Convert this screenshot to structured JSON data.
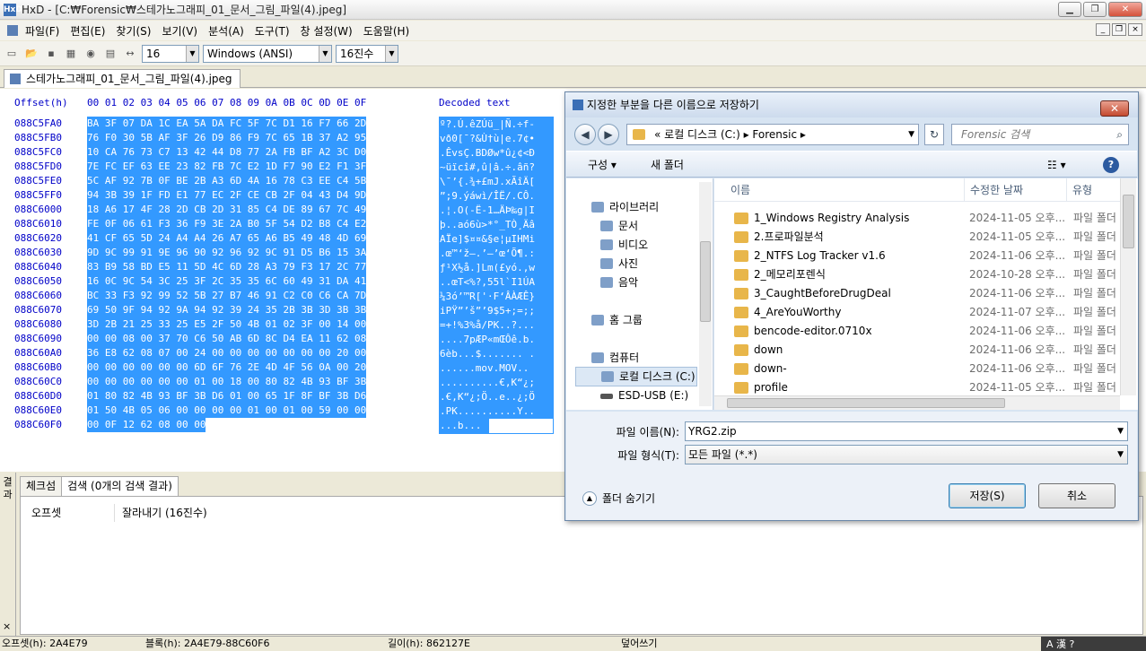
{
  "window": {
    "title": "HxD - [C:₩Forensic₩스테가노그래피_01_문서_그림_파일(4).jpeg]",
    "app_icon": "HxD",
    "minimize": "▁",
    "maximize": "❐",
    "close": "✕"
  },
  "menu": {
    "items": [
      "파일(F)",
      "편집(E)",
      "찾기(S)",
      "보기(V)",
      "분석(A)",
      "도구(T)",
      "창 설정(W)",
      "도움말(H)"
    ],
    "mdi": {
      "minimize": "_",
      "restore": "❐",
      "close": "×"
    }
  },
  "toolbar": {
    "bytes_per_row": "16",
    "charset": "Windows (ANSI)",
    "number_base": "16진수"
  },
  "document_tab": {
    "label": "스테가노그래피_01_문서_그림_파일(4).jpeg"
  },
  "hex_view": {
    "offset_header": "Offset(h)",
    "columns_header": "00 01 02 03 04 05 06 07 08 09 0A 0B 0C 0D 0E 0F",
    "decoded_header": "Decoded text",
    "rows": [
      {
        "offset": "088C5FA0",
        "hex": "BA 3F 07 DA 1C EA 5A DA FC 5F 7C D1 16 F7 66 2D",
        "text": "º?.Ú.êZÚü_|Ñ.÷f-"
      },
      {
        "offset": "088C5FB0",
        "hex": "76 F0 30 5B AF 3F 26 D9 86 F9 7C 65 1B 37 A2 95",
        "text": "vð0[¯?&Ù†ù|e.7¢•"
      },
      {
        "offset": "088C5FC0",
        "hex": "10 CA 76 73 C7 13 42 44 D8 77 2A FB BF A2 3C D0",
        "text": ".ÊvsÇ.BDØw*û¿¢<Ð"
      },
      {
        "offset": "088C5FD0",
        "hex": "7E FC EF 63 EE 23 82 FB 7C E2 1D F7 90 E2 F1 3F",
        "text": "~üïcî#‚û|â.÷.âñ?"
      },
      {
        "offset": "088C5FE0",
        "hex": "5C AF 92 7B 0F BE 2B A3 6D 4A 16 78 C3 EE C4 5B",
        "text": "\\¯’{.¾+£mJ.xÃîÄ["
      },
      {
        "offset": "088C5FF0",
        "hex": "94 3B 39 1F FD E1 77 EC 2F CE CB 2F 04 43 D4 9D",
        "text": "”;9.ýáwì/ÎË/.CÔ."
      },
      {
        "offset": "088C6000",
        "hex": "18 A6 17 4F 28 2D CB 2D 31 85 C4 DE 89 67 7C 49",
        "text": ".¦.O(-Ë-1…ÄÞ‰g|I"
      },
      {
        "offset": "088C6010",
        "hex": "FE 0F 06 61 F3 36 F9 3E 2A B0 5F 54 D2 B8 C4 E2",
        "text": "þ..aó6ù>*°_TÒ¸Äâ"
      },
      {
        "offset": "088C6020",
        "hex": "41 CF 65 5D 24 A4 A4 26 A7 65 A6 B5 49 48 4D 69",
        "text": "AÏe]$¤¤&§e¦µIHMi"
      },
      {
        "offset": "088C6030",
        "hex": "9D 9C 99 91 9E 96 90 92 96 92 9C 91 D5 B6 15 3A",
        "text": ".œ™‘ž–.’–’œ‘Õ¶.:"
      },
      {
        "offset": "088C6040",
        "hex": "83 B9 58 BD E5 11 5D 4C 6D 28 A3 79 F3 17 2C 77",
        "text": "ƒ¹X½å.]Lm(£yó.,w"
      },
      {
        "offset": "088C6050",
        "hex": "16 0C 9C 54 3C 25 3F 2C 35 35 6C 60 49 31 DA 41",
        "text": "..œT<%?,55l`I1ÚA"
      },
      {
        "offset": "088C6060",
        "hex": "BC 33 F3 92 99 52 5B 27 B7 46 91 C2 C0 C6 CA 7D",
        "text": "¼3ó’™R['·F‘ÂÀÆÊ}"
      },
      {
        "offset": "088C6070",
        "hex": "69 50 9F 94 92 9A 94 92 39 24 35 2B 3B 3D 3B 3B",
        "text": "iPŸ”’š”’9$5+;=;;"
      },
      {
        "offset": "088C6080",
        "hex": "3D 2B 21 25 33 25 E5 2F 50 4B 01 02 3F 00 14 00",
        "text": "=+!%3%å/PK..?..."
      },
      {
        "offset": "088C6090",
        "hex": "00 00 08 00 37 70 C6 50 AB 6D 8C D4 EA 11 62 08",
        "text": "....7pÆP«mŒÔê.b."
      },
      {
        "offset": "088C60A0",
        "hex": "36 E8 62 08 07 00 24 00 00 00 00 00 00 00 20 00",
        "text": "6èb...$....... ."
      },
      {
        "offset": "088C60B0",
        "hex": "00 00 00 00 00 00 6D 6F 76 2E 4D 4F 56 0A 00 20",
        "text": "......mov.MOV.. "
      },
      {
        "offset": "088C60C0",
        "hex": "00 00 00 00 00 00 01 00 18 00 80 82 4B 93 BF 3B",
        "text": "..........€‚K“¿;"
      },
      {
        "offset": "088C60D0",
        "hex": "01 80 82 4B 93 BF 3B D6 01 00 65 1F 8F BF 3B D6",
        "text": ".€‚K“¿;Ö..e..¿;Ö"
      },
      {
        "offset": "088C60E0",
        "hex": "01 50 4B 05 06 00 00 00 00 01 00 01 00 59 00 00",
        "text": ".PK..........Y.."
      },
      {
        "offset": "088C60F0",
        "hex": "00 0F 12 62 08 00 00",
        "text": "...b..."
      }
    ]
  },
  "lower_panel": {
    "side_label": "결과",
    "tabs": [
      "체크섬",
      "검색 (0개의 검색 결과)"
    ],
    "columns": [
      "오프셋",
      "잘라내기 (16진수)"
    ],
    "side_close": "×"
  },
  "status": {
    "offset": "오프셋(h): 2A4E79",
    "block": "블록(h): 2A4E79-88C60F6",
    "length": "길이(h): 862127E",
    "mode": "덮어쓰기",
    "ime": "A 漢 ?"
  },
  "dialog": {
    "title": "지정한 부분을 다른 이름으로 저장하기",
    "close": "✕",
    "back": "◀",
    "forward": "▶",
    "address": "« 로컬 디스크 (C:) ▸ Forensic ▸",
    "refresh": "↻",
    "search_placeholder": "Forensic 검색",
    "search_icon": "⌕",
    "organize": "구성 ▾",
    "new_folder": "새 폴더",
    "view": "☷ ▾",
    "help": "?",
    "nav": {
      "libraries": "라이브러리",
      "documents": "문서",
      "videos": "비디오",
      "pictures": "사진",
      "music": "음악",
      "homegroup": "홈 그룹",
      "computer": "컴퓨터",
      "local_disk": "로컬 디스크 (C:)",
      "usb": "ESD-USB (E:)"
    },
    "columns": {
      "name": "이름",
      "date": "수정한 날짜",
      "type": "유형"
    },
    "files": [
      {
        "name": "1_Windows Registry Analysis",
        "date": "2024-11-05 오후...",
        "type": "파일 폴더"
      },
      {
        "name": "2.프로파일분석",
        "date": "2024-11-05 오후...",
        "type": "파일 폴더"
      },
      {
        "name": "2_NTFS Log Tracker v1.6",
        "date": "2024-11-06 오후...",
        "type": "파일 폴더"
      },
      {
        "name": "2_메모리포렌식",
        "date": "2024-10-28 오후...",
        "type": "파일 폴더"
      },
      {
        "name": "3_CaughtBeforeDrugDeal",
        "date": "2024-11-06 오후...",
        "type": "파일 폴더"
      },
      {
        "name": "4_AreYouWorthy",
        "date": "2024-11-07 오후...",
        "type": "파일 폴더"
      },
      {
        "name": "bencode-editor.0710x",
        "date": "2024-11-06 오후...",
        "type": "파일 폴더"
      },
      {
        "name": "down",
        "date": "2024-11-06 오후...",
        "type": "파일 폴더"
      },
      {
        "name": "down-",
        "date": "2024-11-06 오후...",
        "type": "파일 폴더"
      },
      {
        "name": "profile",
        "date": "2024-11-05 오후...",
        "type": "파일 폴더"
      }
    ],
    "filename_label": "파일 이름(N):",
    "filename_value": "YRG2.zip",
    "filetype_label": "파일 형식(T):",
    "filetype_value": "모든 파일 (*.*)",
    "hide_folders": "폴더 숨기기",
    "save": "저장(S)",
    "cancel": "취소"
  }
}
